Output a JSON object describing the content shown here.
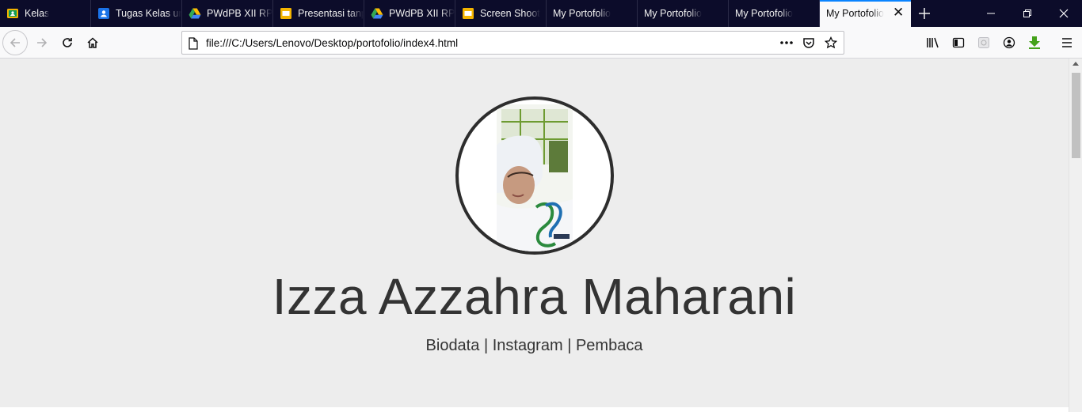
{
  "browser": {
    "tabs": [
      {
        "label": "Kelas",
        "icon": "google-classroom-icon",
        "color": "#f4b400"
      },
      {
        "label": "Tugas Kelas untuk",
        "icon": "google-classroom-assignment-icon",
        "color": "#1a73e8"
      },
      {
        "label": "PWdPB XII RPL",
        "icon": "google-drive-icon",
        "color": "#34a853"
      },
      {
        "label": "Presentasi tanpa",
        "icon": "google-slides-icon",
        "color": "#f4b400"
      },
      {
        "label": "PWdPB XII RPL",
        "icon": "google-drive-icon",
        "color": "#34a853"
      },
      {
        "label": "Screen Shoot",
        "icon": "google-slides-icon",
        "color": "#f4b400"
      },
      {
        "label": "My Portofolio",
        "icon": "",
        "color": ""
      },
      {
        "label": "My Portofolio",
        "icon": "",
        "color": ""
      },
      {
        "label": "My Portofolio",
        "icon": "",
        "color": ""
      }
    ],
    "active_tab": {
      "label": "My Portofolio"
    },
    "url": "file:///C:/Users/Lenovo/Desktop/portofolio/index4.html",
    "accent": "#0a84ff"
  },
  "page": {
    "name": "Izza Azzahra Maharani",
    "links": [
      "Biodata",
      "Instagram",
      "Pembaca"
    ],
    "separator": "|"
  }
}
